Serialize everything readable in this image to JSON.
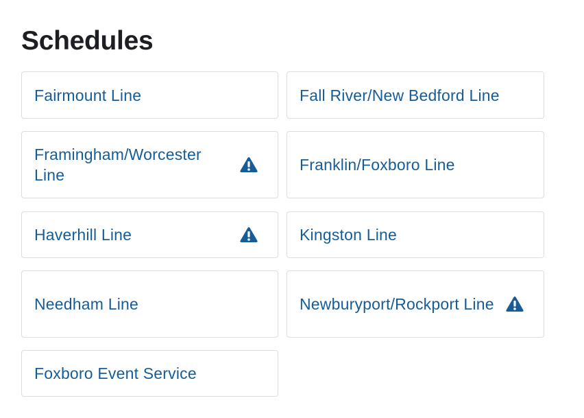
{
  "page_title": "Schedules",
  "colors": {
    "link": "#165c96",
    "heading": "#1c1e23",
    "card_border": "#dcdde0"
  },
  "lines": [
    {
      "label": "Fairmount Line",
      "alert": false
    },
    {
      "label": "Fall River/New Bedford Line",
      "alert": false
    },
    {
      "label": "Framingham/Worcester Line",
      "alert": true
    },
    {
      "label": "Franklin/Foxboro Line",
      "alert": false
    },
    {
      "label": "Haverhill Line",
      "alert": true
    },
    {
      "label": "Kingston Line",
      "alert": false
    },
    {
      "label": "Needham Line",
      "alert": false
    },
    {
      "label": "Newburyport/Rockport Line",
      "alert": true
    },
    {
      "label": "Foxboro Event Service",
      "alert": false
    }
  ],
  "alert_icon": "warning-triangle-icon"
}
